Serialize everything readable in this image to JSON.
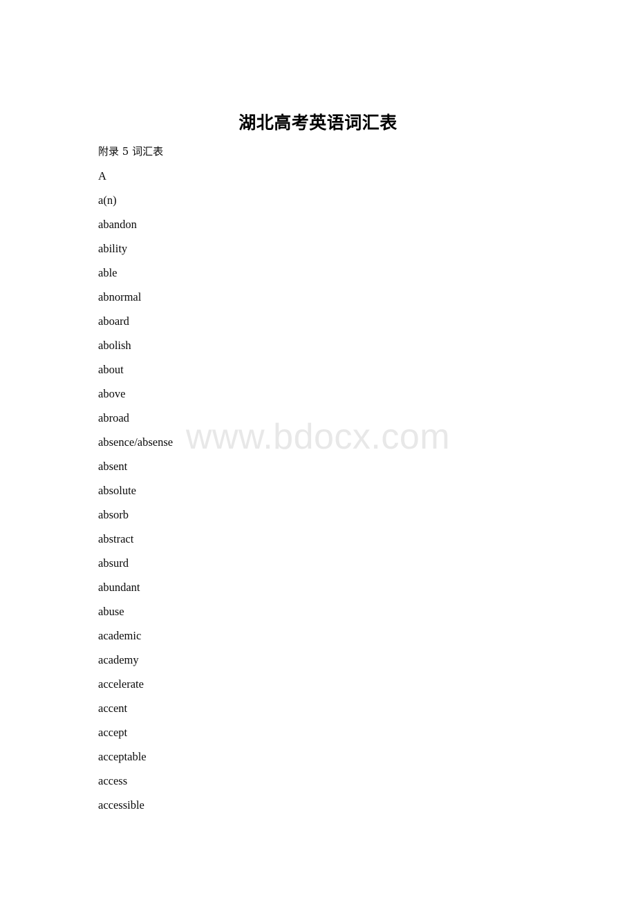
{
  "document": {
    "title": "湖北高考英语词汇表",
    "subtitle": "附录 5 词汇表",
    "section_letter": "A",
    "watermark": "www.bdocx.com",
    "watermark_color": "#e8e8e8",
    "text_color": "#0a0a0a",
    "background_color": "#ffffff"
  },
  "vocabulary": {
    "entries": [
      "a(n)",
      "abandon",
      "ability",
      "able",
      "abnormal",
      "aboard",
      "abolish",
      "about",
      "above",
      "abroad",
      "absence/absense",
      "absent",
      "absolute",
      "absorb",
      "abstract",
      "absurd",
      "abundant",
      "abuse",
      "academic",
      "academy",
      "accelerate",
      "accent",
      "accept",
      "acceptable",
      "access",
      "accessible"
    ]
  }
}
